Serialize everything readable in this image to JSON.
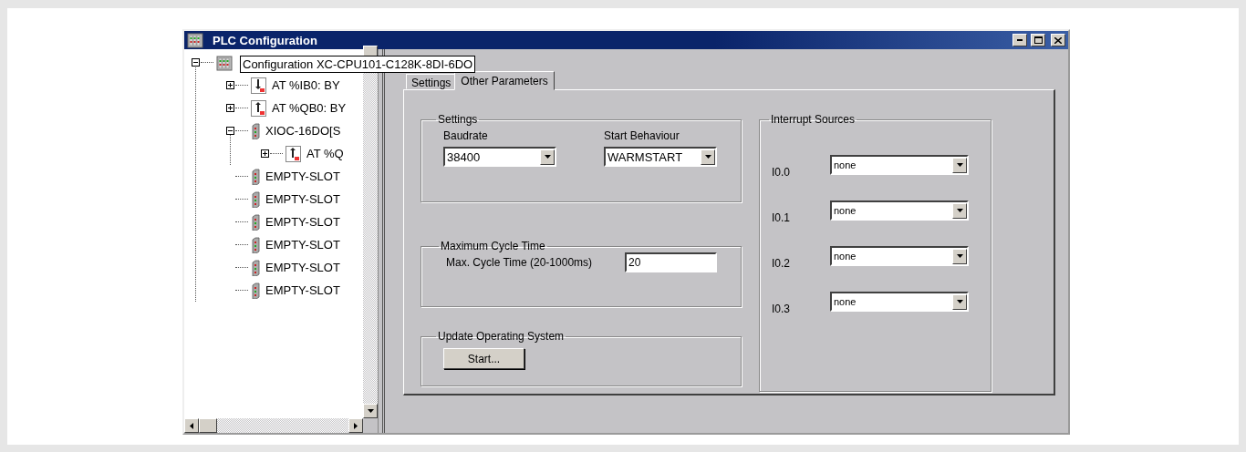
{
  "window": {
    "title": "PLC Configuration"
  },
  "tree": {
    "label": "Configuration XC-CPU101-C128K-8DI-6DO",
    "kind": "cpu",
    "expanded": true,
    "children": [
      {
        "label": "AT %IB0: BY",
        "kind": "input",
        "expanded": false
      },
      {
        "label": "AT %QB0: BY",
        "kind": "output",
        "expanded": false
      },
      {
        "label": "XIOC-16DO[S",
        "kind": "module",
        "expanded": true,
        "children": [
          {
            "label": "AT %Q",
            "kind": "output16",
            "expanded": false
          }
        ]
      },
      {
        "label": "EMPTY-SLOT",
        "kind": "module"
      },
      {
        "label": "EMPTY-SLOT",
        "kind": "module"
      },
      {
        "label": "EMPTY-SLOT",
        "kind": "module"
      },
      {
        "label": "EMPTY-SLOT",
        "kind": "module"
      },
      {
        "label": "EMPTY-SLOT",
        "kind": "module"
      },
      {
        "label": "EMPTY-SLOT",
        "kind": "module"
      }
    ]
  },
  "tabs": [
    {
      "label": "Settings",
      "selected": false
    },
    {
      "label": "Other Parameters",
      "selected": true
    }
  ],
  "settings_group": {
    "title": "Settings",
    "baudrate": {
      "label": "Baudrate",
      "value": "38400"
    },
    "start_behaviour": {
      "label": "Start Behaviour",
      "value": "WARMSTART"
    }
  },
  "cycle_group": {
    "title": "Maximum Cycle Time",
    "label": "Max. Cycle Time (20-1000ms)",
    "value": "20"
  },
  "update_group": {
    "title": "Update Operating System",
    "button": "Start..."
  },
  "interrupt_group": {
    "title": "Interrupt Sources",
    "sources": [
      {
        "label": "I0.0",
        "value": "none"
      },
      {
        "label": "I0.1",
        "value": "none"
      },
      {
        "label": "I0.2",
        "value": "none"
      },
      {
        "label": "I0.3",
        "value": "none"
      }
    ]
  }
}
